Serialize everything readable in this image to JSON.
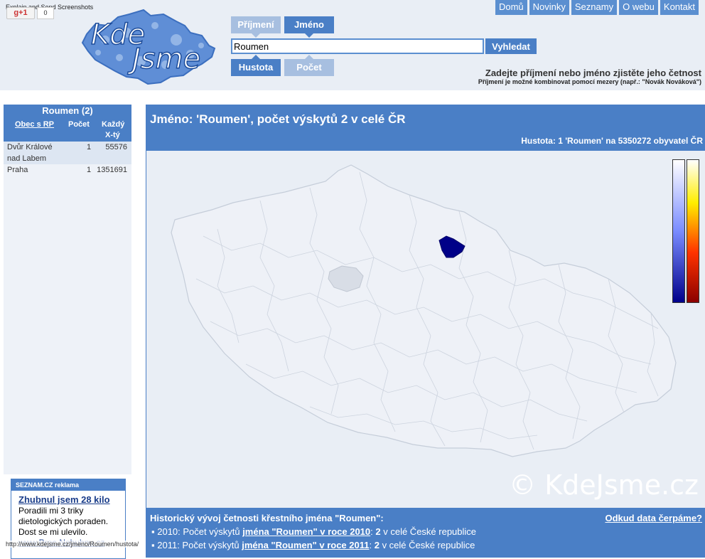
{
  "extension": {
    "label": "Explain and Send Screenshots",
    "gplus_label": "g+1",
    "gplus_count": "0"
  },
  "logo": {
    "line1": "Kde",
    "line2": "Jsme"
  },
  "nav": [
    "Domů",
    "Novinky",
    "Seznamy",
    "O webu",
    "Kontakt"
  ],
  "search": {
    "tab_surname": "Příjmení",
    "tab_name": "Jméno",
    "value": "Roumen",
    "button": "Vyhledat",
    "tab_density": "Hustota",
    "tab_count": "Počet",
    "hint": "Zadejte příjmení nebo jméno zjistěte jeho četnost",
    "hint_small": "Příjmení je možné kombinovat pomocí mezery (např.: \"Novák Nováková\")"
  },
  "sidebar": {
    "title": "Roumen (2)",
    "col_obec": "Obec s RP",
    "col_pocet": "Počet",
    "col_kazdy_1": "Každý",
    "col_kazdy_2": "X-tý",
    "rows": [
      {
        "obec_1": "Dvůr Králové",
        "obec_2": "nad Labem",
        "pocet": "1",
        "kazdy": "55576"
      },
      {
        "obec_1": "Praha",
        "obec_2": "",
        "pocet": "1",
        "kazdy": "1351691"
      }
    ]
  },
  "ad": {
    "brand": "SEZNAM.CZ",
    "label": "reklama",
    "title": "Zhubnul jsem 28 kilo",
    "body": "Poradili mi 3 triky dietologických poraden. Dost se mi ulevilo.",
    "link": "www.Proc-Nehubnu.cz"
  },
  "status_url": "http://www.kdejsme.cz/jmeno/Roumen/hustota/",
  "main": {
    "title": "Jméno: 'Roumen', počet výskytů 2 v celé ČR",
    "density": "Hustota: 1 'Roumen' na 5350272 obyvatel ČR",
    "watermark": "© KdeJsme.cz",
    "colors": {
      "highlight": "#000088",
      "praha": "#d8dde6",
      "region": "#eef1f7",
      "border": "#c5cdd9"
    }
  },
  "history": {
    "title": "Historický vývoj četnosti křestního jména \"Roumen\":",
    "source_link": "Odkud data čerpáme?",
    "items": [
      {
        "prefix": "2010: Počet výskytů ",
        "link": "jména \"Roumen\" v roce 2010",
        "count": "2",
        "suffix": " v celé České republice"
      },
      {
        "prefix": "2011: Počet výskytů ",
        "link": "jména \"Roumen\" v roce 2011",
        "count": "2",
        "suffix": " v celé České republice"
      }
    ]
  }
}
